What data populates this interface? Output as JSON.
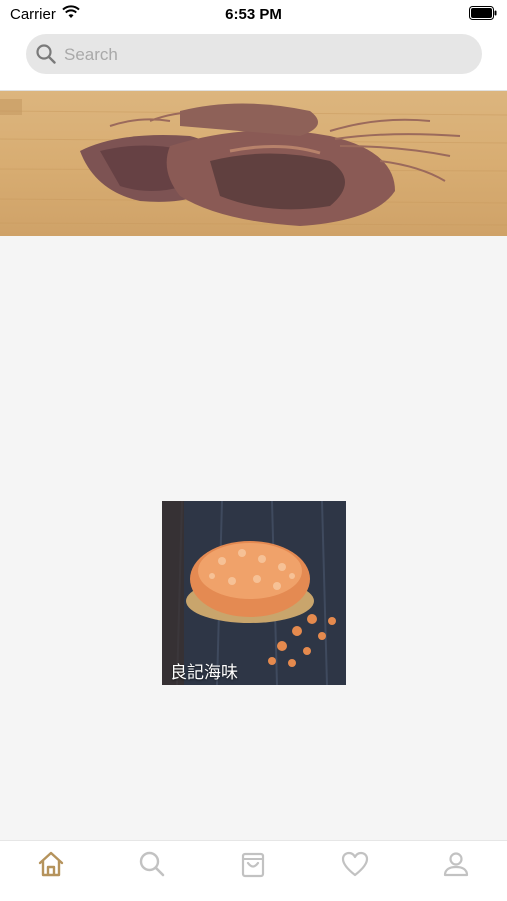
{
  "status_bar": {
    "carrier": "Carrier",
    "time": "6:53 PM"
  },
  "search": {
    "placeholder": "Search"
  },
  "banner": {
    "image": "dried-squid-on-bamboo-board"
  },
  "products": [
    {
      "name": "良記海味",
      "image": "dried-shrimp-basket"
    }
  ],
  "tab_bar": {
    "tabs": [
      {
        "icon": "home-icon",
        "active": true
      },
      {
        "icon": "search-icon",
        "active": false
      },
      {
        "icon": "shopping-bag-icon",
        "active": false
      },
      {
        "icon": "heart-icon",
        "active": false
      },
      {
        "icon": "user-icon",
        "active": false
      }
    ],
    "active_color": "#b5935c",
    "inactive_color": "#c2c2c2"
  }
}
